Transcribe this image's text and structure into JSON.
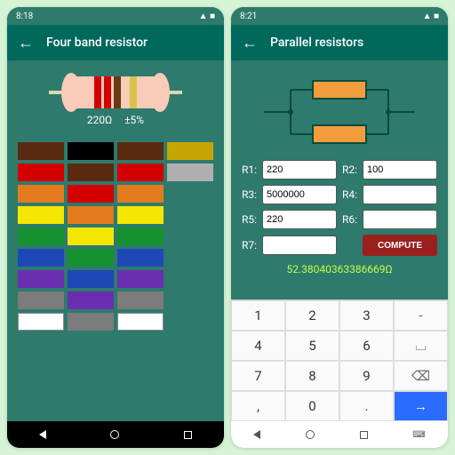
{
  "left": {
    "time": "8:18",
    "title": "Four band resistor",
    "value": "220Ω",
    "tolerance": "±5%",
    "bands": [
      "#d40000",
      "#d40000",
      "#6b3a12",
      "#d8c34a"
    ],
    "palette": [
      "#5a2a10",
      "#000000",
      "#5a2a10",
      "#c7a500",
      "#d40000",
      "#5a2a10",
      "#d40000",
      "#b0b0b0",
      "#e37a1e",
      "#d40000",
      "#e37a1e",
      "",
      "#f4e600",
      "#e37a1e",
      "#f4e600",
      "",
      "#159131",
      "#f4e600",
      "#159131",
      "",
      "#1e48b5",
      "#159131",
      "#1e48b5",
      "",
      "#6a2fb0",
      "#1e48b5",
      "#6a2fb0",
      "",
      "#7c7c7c",
      "#6a2fb0",
      "#7c7c7c",
      "",
      "#ffffff",
      "#7c7c7c",
      "#ffffff",
      ""
    ]
  },
  "right": {
    "time": "8:21",
    "title": "Parallel resistors",
    "labels": {
      "r1": "R1:",
      "r2": "R2:",
      "r3": "R3:",
      "r4": "R4:",
      "r5": "R5:",
      "r6": "R6:",
      "r7": "R7:"
    },
    "values": {
      "r1": "220",
      "r2": "100",
      "r3": "5000000",
      "r4": "",
      "r5": "220",
      "r6": "",
      "r7": ""
    },
    "compute": "COMPUTE",
    "result": "52.38040363386669Ω",
    "keys": [
      "1",
      "2",
      "3",
      "-",
      "4",
      "5",
      "6",
      "␣",
      "7",
      "8",
      "9",
      "⌫",
      ",",
      "0",
      ".",
      "→"
    ]
  }
}
